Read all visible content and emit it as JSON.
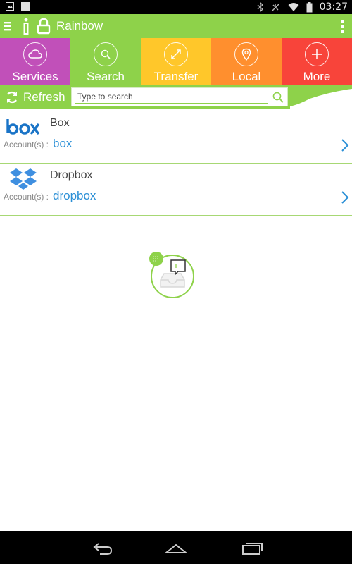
{
  "status_bar": {
    "time": "03:27",
    "icons": [
      "image-notification-icon",
      "barcode-notification-icon",
      "bluetooth-icon",
      "signal-off-icon",
      "wifi-icon",
      "battery-icon"
    ]
  },
  "action_bar": {
    "title": "Rainbow",
    "icons": [
      "menu-icon",
      "info-icon",
      "lock-icon",
      "overflow-menu-icon"
    ]
  },
  "tabs": [
    {
      "label": "Services",
      "icon": "cloud-icon",
      "color": "#c150b9"
    },
    {
      "label": "Search",
      "icon": "search-icon",
      "color": "#8ed24a"
    },
    {
      "label": "Transfer",
      "icon": "transfer-arrows-icon",
      "color": "#ffc72a"
    },
    {
      "label": "Local",
      "icon": "location-pin-icon",
      "color": "#ff8f2e"
    },
    {
      "label": "More",
      "icon": "plus-icon",
      "color": "#f8443a"
    }
  ],
  "refresh": {
    "label": "Refresh",
    "icon": "refresh-icon"
  },
  "search": {
    "placeholder": "Type to search",
    "icon": "search-icon"
  },
  "accounts": [
    {
      "name": "Box",
      "caption": "Account(s) :",
      "account": "box",
      "logo": "box-logo"
    },
    {
      "name": "Dropbox",
      "caption": "Account(s) :",
      "account": "dropbox",
      "logo": "dropbox-logo"
    }
  ],
  "empty_state": {
    "icon": "empty-inbox-icon"
  },
  "colors": {
    "accent_green": "#8ed24a",
    "link_blue": "#2a8fd6",
    "divider": "#a7d874"
  },
  "nav_bar": {
    "icons": [
      "back-icon",
      "home-icon",
      "recent-apps-icon"
    ]
  }
}
